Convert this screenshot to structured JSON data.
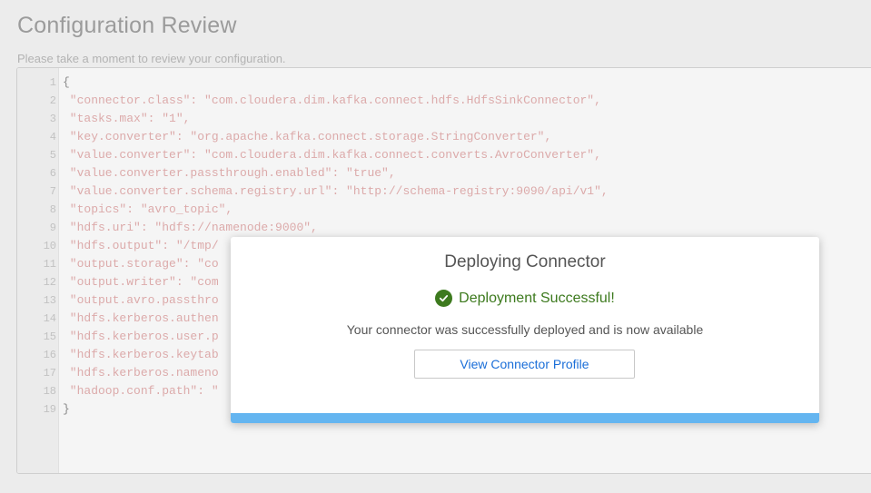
{
  "page": {
    "title": "Configuration Review",
    "subtitle": "Please take a moment to review your configuration."
  },
  "editor": {
    "lines": [
      {
        "no": "1",
        "text": "{"
      },
      {
        "no": "2",
        "text": " \"connector.class\": \"com.cloudera.dim.kafka.connect.hdfs.HdfsSinkConnector\","
      },
      {
        "no": "3",
        "text": " \"tasks.max\": \"1\","
      },
      {
        "no": "4",
        "text": " \"key.converter\": \"org.apache.kafka.connect.storage.StringConverter\","
      },
      {
        "no": "5",
        "text": " \"value.converter\": \"com.cloudera.dim.kafka.connect.converts.AvroConverter\","
      },
      {
        "no": "6",
        "text": " \"value.converter.passthrough.enabled\": \"true\","
      },
      {
        "no": "7",
        "text": " \"value.converter.schema.registry.url\": \"http://schema-registry:9090/api/v1\","
      },
      {
        "no": "8",
        "text": " \"topics\": \"avro_topic\","
      },
      {
        "no": "9",
        "text": " \"hdfs.uri\": \"hdfs://namenode:9000\","
      },
      {
        "no": "10",
        "text": " \"hdfs.output\": \"/tmp/"
      },
      {
        "no": "11",
        "text": " \"output.storage\": \"co"
      },
      {
        "no": "12",
        "text": " \"output.writer\": \"com"
      },
      {
        "no": "13",
        "text": " \"output.avro.passthro"
      },
      {
        "no": "14",
        "text": " \"hdfs.kerberos.authen"
      },
      {
        "no": "15",
        "text": " \"hdfs.kerberos.user.p"
      },
      {
        "no": "16",
        "text": " \"hdfs.kerberos.keytab"
      },
      {
        "no": "17",
        "text": " \"hdfs.kerberos.nameno"
      },
      {
        "no": "18",
        "text": " \"hadoop.conf.path\": \""
      },
      {
        "no": "19",
        "text": "}"
      }
    ]
  },
  "modal": {
    "title": "Deploying Connector",
    "status": "Deployment Successful!",
    "message": "Your connector was successfully deployed and is now available",
    "button_label": "View Connector Profile",
    "progress_percent": 100
  },
  "colors": {
    "success": "#3d7a1e",
    "link": "#1a6ed8",
    "progress": "#64b5f0",
    "code_string": "#dcaaaa"
  },
  "icons": {
    "status": "check-circle-icon"
  }
}
